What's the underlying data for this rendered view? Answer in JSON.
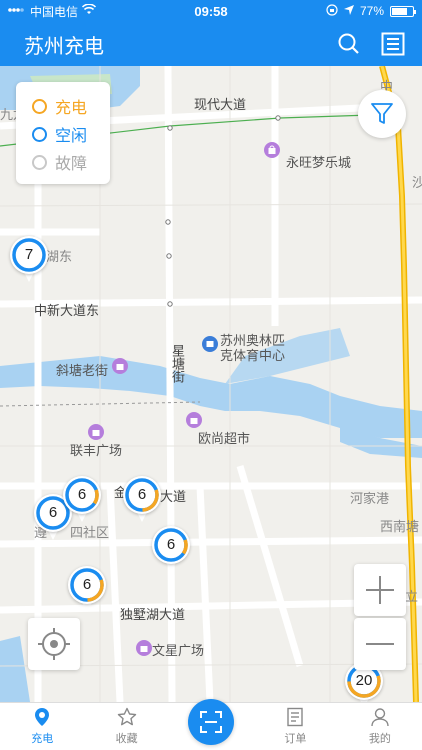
{
  "status_bar": {
    "carrier": "中国电信",
    "time": "09:58",
    "battery": "77%",
    "battery_level": 0.77
  },
  "header": {
    "title": "苏州充电"
  },
  "legend": [
    {
      "label": "充电",
      "color": "#f5a623"
    },
    {
      "label": "空闲",
      "color": "#1a8cf0"
    },
    {
      "label": "故障",
      "color": "#c8c8c8"
    }
  ],
  "map_labels": {
    "xiandai": "现代大道",
    "yongwang": "永旺梦乐城",
    "hudong": "湖东",
    "zhongxin": "中新大道东",
    "olympic_1": "苏州奥林匹",
    "olympic_2": "克体育中心",
    "xietang": "斜塘老街",
    "xingtang": "星塘街",
    "auchan": "欧尚超市",
    "lianfeng": "联丰广场",
    "hejia": "河家港",
    "xinantang": "西南塘",
    "dushu": "独墅湖大道",
    "wenxing": "文星广场",
    "sha": "沙",
    "zhong": "中",
    "dao": "岛立",
    "road_frag1": "大道",
    "road_frag2": "遵",
    "road_frag3": "四社区",
    "jiulong": "九龙",
    "jin": "金"
  },
  "markers": [
    {
      "count": "7",
      "charging_frac": 0.0
    },
    {
      "count": "6",
      "charging_frac": 0.0
    },
    {
      "count": "6",
      "charging_frac": 0.15
    },
    {
      "count": "6",
      "charging_frac": 0.3
    },
    {
      "count": "6",
      "charging_frac": 0.15
    },
    {
      "count": "6",
      "charging_frac": 0.3
    },
    {
      "count": "20",
      "charging_frac": 0.55
    }
  ],
  "tabs": [
    {
      "label": "充电",
      "icon": "location-pin-icon",
      "active": true
    },
    {
      "label": "收藏",
      "icon": "star-icon",
      "active": false
    },
    {
      "label": "",
      "icon": "scan-icon",
      "active": false
    },
    {
      "label": "订单",
      "icon": "order-icon",
      "active": false
    },
    {
      "label": "我的",
      "icon": "user-icon",
      "active": false
    }
  ],
  "colors": {
    "primary": "#1a8cf0",
    "charging": "#f5a623",
    "idle": "#1a8cf0",
    "fault": "#c8c8c8",
    "road_major": "#f5c518"
  }
}
